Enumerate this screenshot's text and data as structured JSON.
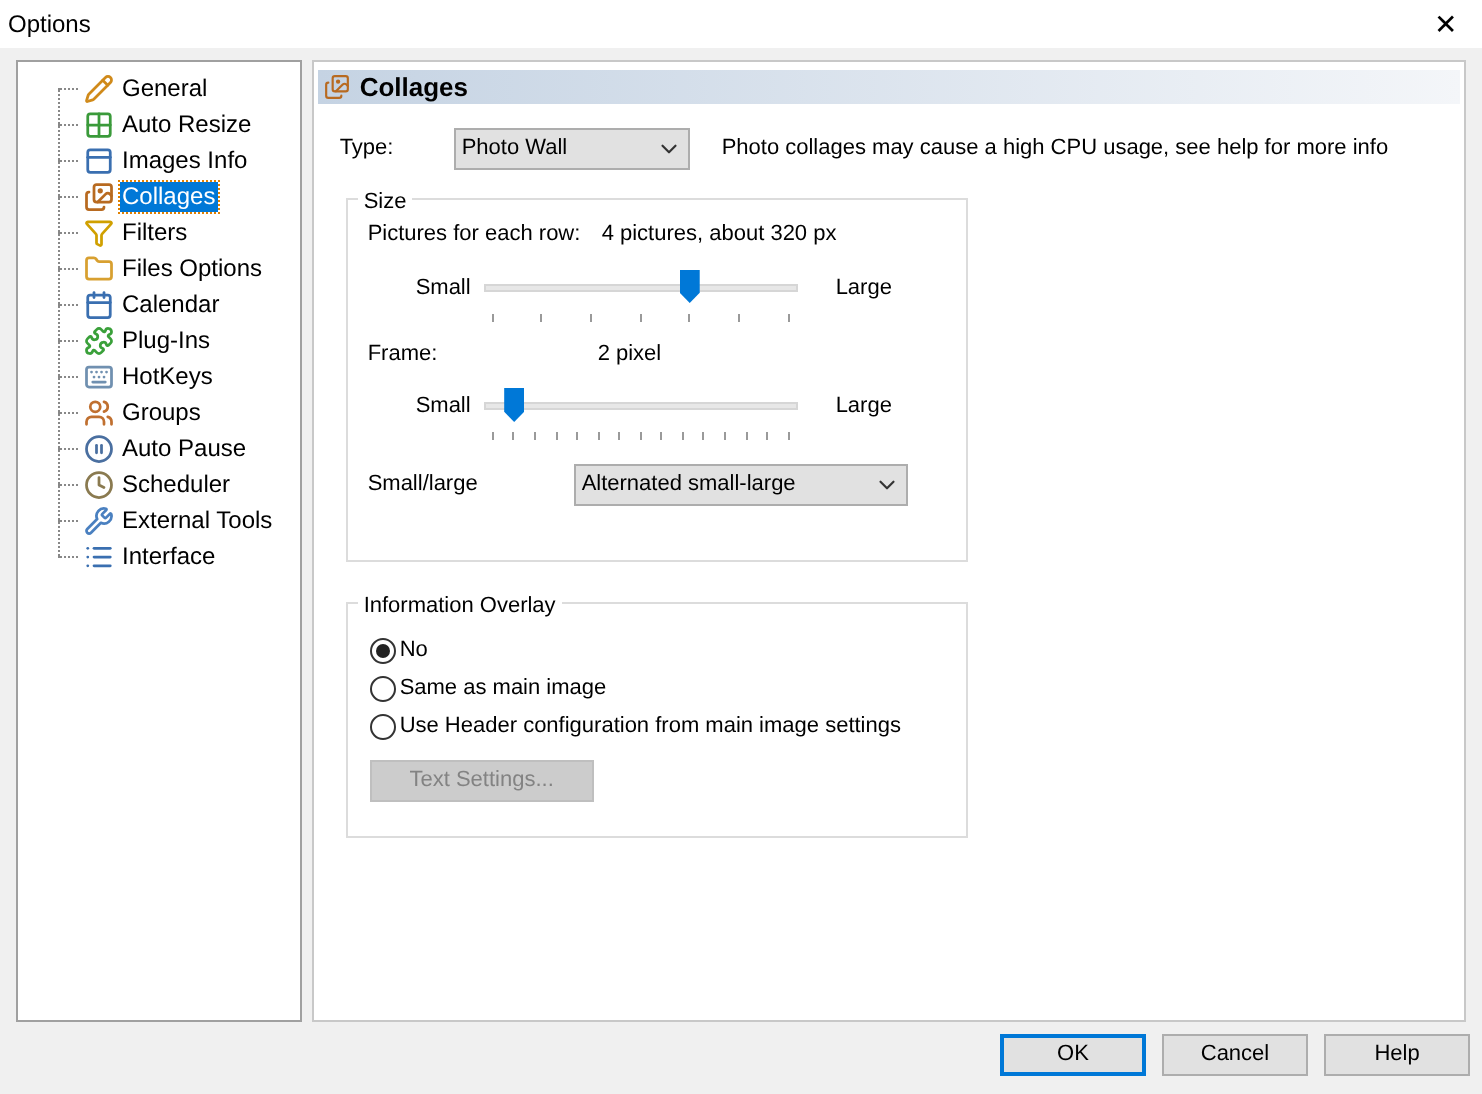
{
  "window": {
    "title": "Options",
    "close": "✕"
  },
  "tree": {
    "items": [
      {
        "label": "General",
        "selected": false
      },
      {
        "label": "Auto Resize",
        "selected": false
      },
      {
        "label": "Images Info",
        "selected": false
      },
      {
        "label": "Collages",
        "selected": true
      },
      {
        "label": "Filters",
        "selected": false
      },
      {
        "label": "Files Options",
        "selected": false
      },
      {
        "label": "Calendar",
        "selected": false
      },
      {
        "label": "Plug-Ins",
        "selected": false
      },
      {
        "label": "HotKeys",
        "selected": false
      },
      {
        "label": "Groups",
        "selected": false
      },
      {
        "label": "Auto Pause",
        "selected": false
      },
      {
        "label": "Scheduler",
        "selected": false
      },
      {
        "label": "External Tools",
        "selected": false
      },
      {
        "label": "Interface",
        "selected": false
      }
    ]
  },
  "page": {
    "title": "Collages",
    "type": {
      "label": "Type:",
      "value": "Photo Wall",
      "note": "Photo collages may cause a high CPU usage, see help for more info"
    },
    "size": {
      "legend": "Size",
      "pictures": {
        "label": "Pictures for each row:",
        "value": "4 pictures, about 320 px",
        "min_label": "Small",
        "max_label": "Large",
        "level": 0.667
      },
      "frame": {
        "label": "Frame:",
        "value": "2 pixel",
        "min_label": "Small",
        "max_label": "Large",
        "level": 0.07
      },
      "small_large": {
        "label": "Small/large",
        "value": "Alternated small-large"
      }
    },
    "overlay": {
      "legend": "Information Overlay",
      "options": [
        {
          "label": "No",
          "selected": true
        },
        {
          "label": "Same as main image",
          "selected": false
        },
        {
          "label": "Use Header configuration from main image settings",
          "selected": false
        }
      ],
      "text_settings": {
        "label": "Text Settings...",
        "disabled": true
      }
    }
  },
  "buttons": [
    {
      "label": "OK",
      "default": true
    },
    {
      "label": "Cancel",
      "default": false
    },
    {
      "label": "Help",
      "default": false
    }
  ]
}
